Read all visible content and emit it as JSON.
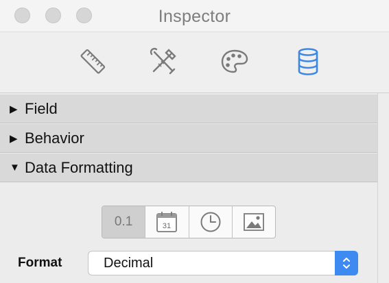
{
  "window": {
    "title": "Inspector"
  },
  "toolbar": {
    "tabs": [
      {
        "icon": "ruler-icon",
        "active": false
      },
      {
        "icon": "tools-icon",
        "active": false
      },
      {
        "icon": "palette-icon",
        "active": false
      },
      {
        "icon": "database-icon",
        "active": true
      }
    ],
    "active_color": "#3a87e6"
  },
  "sections": [
    {
      "label": "Field",
      "expanded": false
    },
    {
      "label": "Behavior",
      "expanded": false
    },
    {
      "label": "Data Formatting",
      "expanded": true
    }
  ],
  "data_formatting": {
    "type_buttons": [
      {
        "text": "0.1",
        "icon": "number-icon",
        "selected": true
      },
      {
        "text": "31",
        "icon": "calendar-icon",
        "selected": false
      },
      {
        "icon": "clock-icon",
        "selected": false
      },
      {
        "icon": "image-icon",
        "selected": false
      }
    ],
    "format_label": "Format",
    "format_value": "Decimal"
  }
}
